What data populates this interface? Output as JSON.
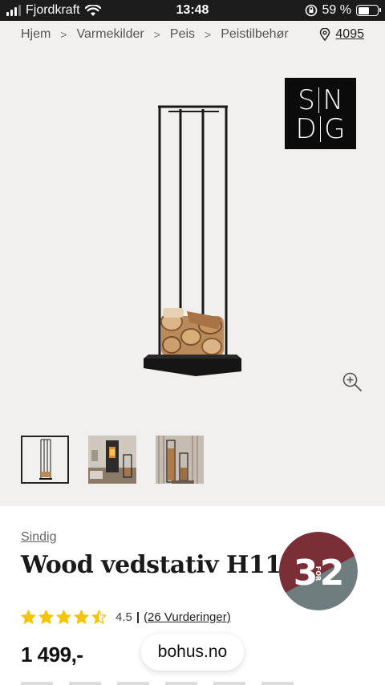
{
  "status_bar": {
    "carrier": "Fjordkraft",
    "time": "13:48",
    "battery_percent": "59 %",
    "battery_level": 0.59
  },
  "breadcrumb": {
    "items": [
      "Hjem",
      "Varmekilder",
      "Peis",
      "Peistilbehør"
    ],
    "location_code": "4095"
  },
  "brand_logo": {
    "row1": [
      "S",
      "N"
    ],
    "row2": [
      "D",
      "G"
    ],
    "letter_i": "I"
  },
  "product": {
    "brand": "Sindig",
    "title": "Wood vedstativ H115",
    "rating": "4.5",
    "rating_value": 4.5,
    "rating_separator": "|",
    "reviews_label": "(26 Vurderinger)",
    "price": "1 499,-"
  },
  "badge": {
    "left": "3",
    "right": "2",
    "middle": "FOR",
    "colors": {
      "top": "#7a2e35",
      "bottom": "#6f7d7e"
    }
  },
  "browser": {
    "url": "bohus.no"
  },
  "colors": {
    "star": "#f5c400",
    "status_bg": "#1c1c1c",
    "page_bg": "#f2f0ee"
  }
}
